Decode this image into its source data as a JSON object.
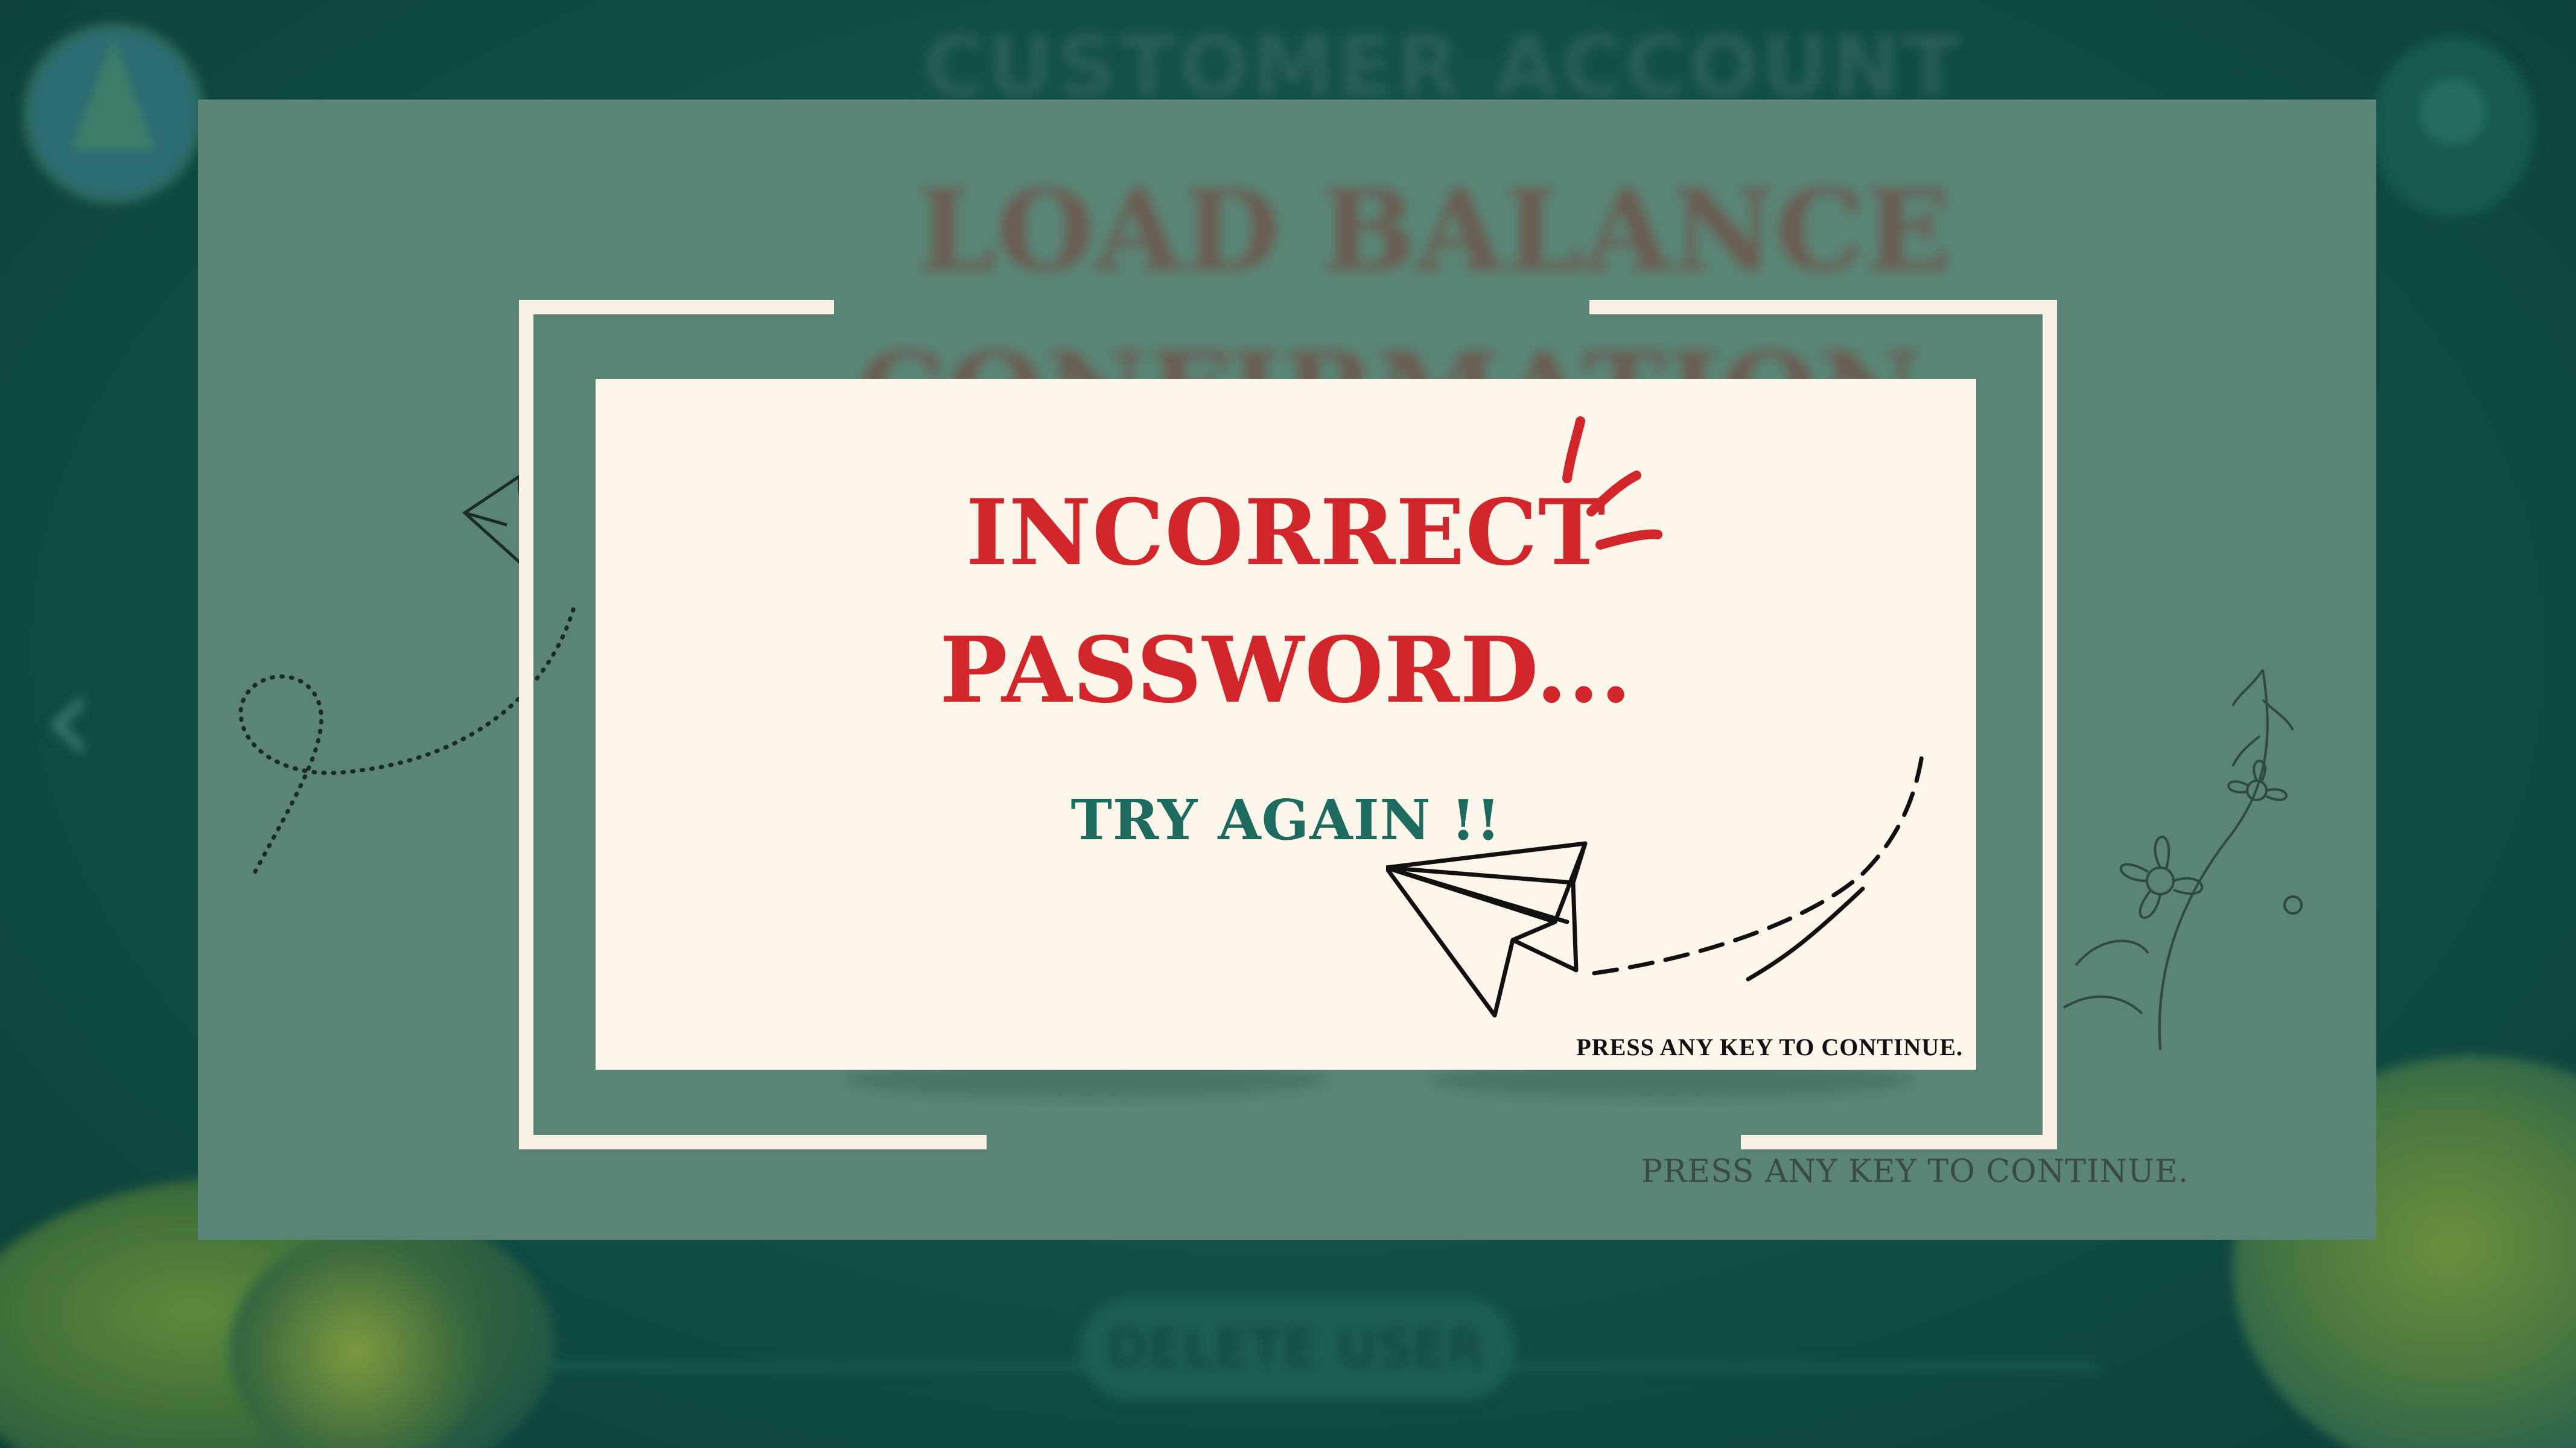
{
  "background": {
    "header_title": "CUSTOMER ACCOUNT",
    "heading_line1": "LOAD BALANCE",
    "heading_line2": "CONFIRMATION",
    "press_hint": "PRESS ANY KEY TO CONTINUE.",
    "delete_button_label": "DELETE USER",
    "back_arrow": "‹",
    "icons": [
      "logo-icon",
      "user-icon",
      "back-arrow-icon",
      "paper-plane-icon",
      "flower-icon"
    ]
  },
  "dialog": {
    "message_line1": "INCORRECT",
    "message_line2": "PASSWORD...",
    "retry_text": "TRY AGAIN !!",
    "continue_hint": "PRESS ANY KEY TO CONTINUE.",
    "icons": [
      "burst-icon",
      "paper-plane-icon"
    ]
  },
  "colors": {
    "page_background": "#0f4a42",
    "panel": "#5a8576",
    "frame": "#f8f1e4",
    "dialog_background": "#fcf5e9",
    "error_text": "#d3262b",
    "retry_text": "#1d6a5f",
    "hint_text": "#111111"
  }
}
